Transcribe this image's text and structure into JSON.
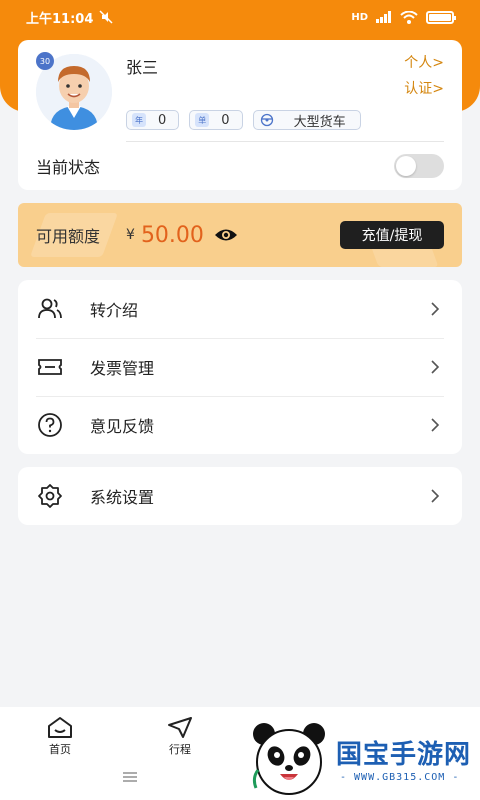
{
  "status_bar": {
    "time": "上午11:04",
    "network": "HD",
    "signal": "4G"
  },
  "profile": {
    "name": "张三",
    "avatar_badge": "30",
    "personal_link": "个人>",
    "auth_link": "认证>",
    "tags": [
      {
        "icon": "年",
        "value": "0"
      },
      {
        "icon": "单",
        "value": "0"
      },
      {
        "icon": "steering-wheel-icon",
        "value": "大型货车"
      }
    ],
    "status_label": "当前状态",
    "status_on": false
  },
  "balance": {
    "label": "可用额度",
    "currency": "¥",
    "amount": "50.00",
    "button": "充值/提现"
  },
  "menu": [
    {
      "label": "转介绍",
      "icon": "people-icon"
    },
    {
      "label": "发票管理",
      "icon": "ticket-icon"
    },
    {
      "label": "意见反馈",
      "icon": "question-icon"
    }
  ],
  "settings": {
    "label": "系统设置",
    "icon": "gear-icon"
  },
  "bottom_nav": [
    {
      "label": "首页",
      "icon": "home-icon"
    },
    {
      "label": "行程",
      "icon": "navigation-icon"
    }
  ],
  "watermark": {
    "text": "国宝手游网",
    "url": "- WWW.GB315.COM -"
  },
  "colors": {
    "accent": "#f58a0c",
    "balance_bg": "#f9cf8d",
    "amount": "#e2621c",
    "link": "#d4860f"
  }
}
